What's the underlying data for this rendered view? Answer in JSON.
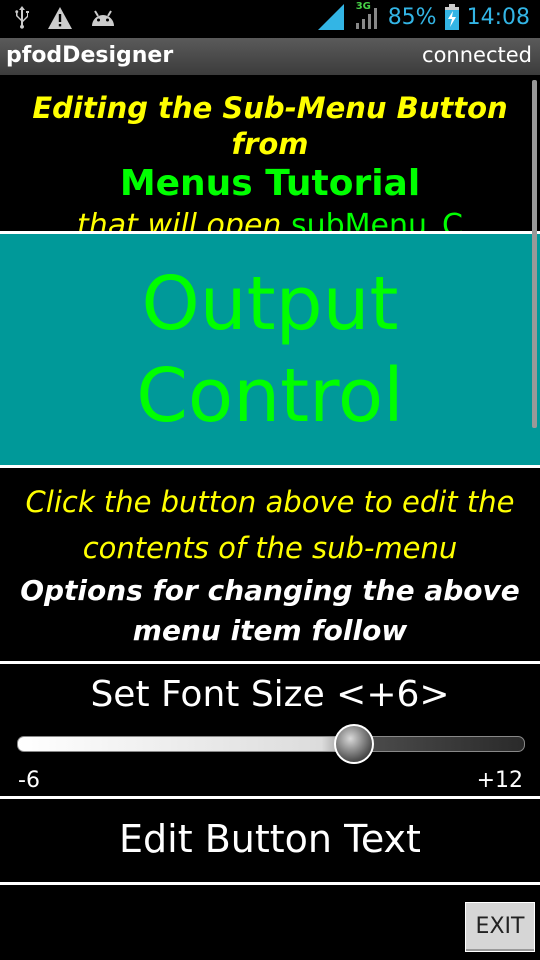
{
  "status_bar": {
    "icons_left": [
      "usb-icon",
      "warning-icon",
      "android-icon"
    ],
    "network_type": "3G",
    "battery_percent": "85%",
    "time": "14:08"
  },
  "title_bar": {
    "app_title": "pfodDesigner",
    "connection_status": "connected"
  },
  "header": {
    "line1": "Editing the Sub-Menu Button from",
    "line2": "Menus Tutorial",
    "line3_prefix": "that will open ",
    "line3_target": "subMenu_C"
  },
  "submenu_button": {
    "line1": "Output",
    "line2": "Control"
  },
  "info": {
    "instruction_line1": "Click the button above to edit the",
    "instruction_line2": "contents of the sub-menu",
    "options_line1": "Options for changing the above",
    "options_line2": "menu item follow"
  },
  "font_size": {
    "label": "Set Font Size <+6>",
    "min_label": "-6",
    "max_label": "+12",
    "value": 6,
    "min": -6,
    "max": 12
  },
  "edit_button": {
    "label": "Edit Button Text"
  },
  "exit_button": {
    "label": "EXIT"
  },
  "colors": {
    "yellow": "#ffff00",
    "green": "#00ff00",
    "teal": "#009999",
    "status_blue": "#33b5e5"
  }
}
